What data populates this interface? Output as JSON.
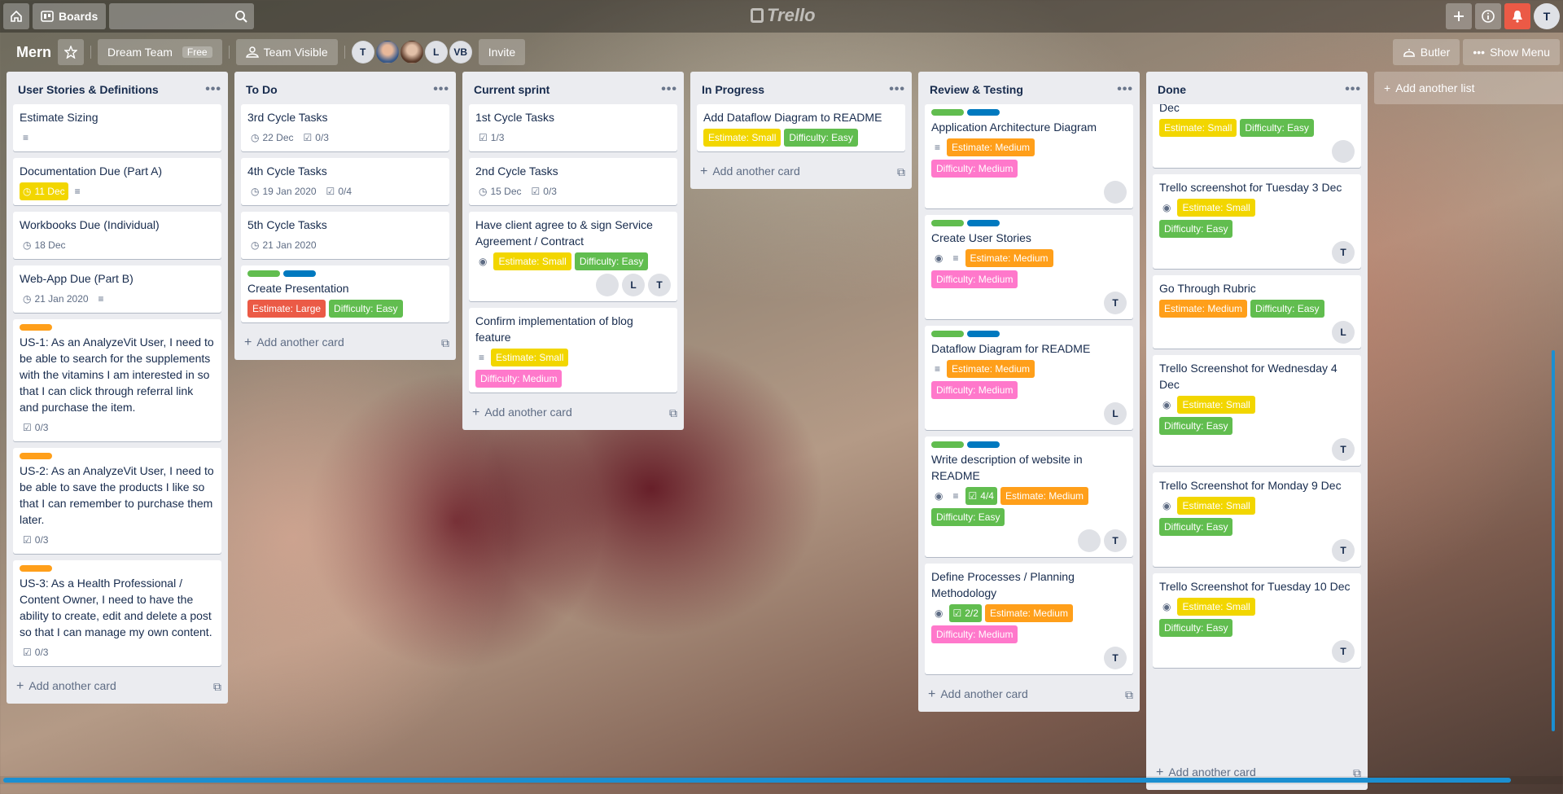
{
  "topbar": {
    "boards_label": "Boards",
    "logo": "Trello",
    "user_initial": "T"
  },
  "board": {
    "name": "Mern",
    "team": "Dream Team",
    "team_badge": "Free",
    "visibility": "Team Visible",
    "members": [
      "T",
      "L",
      "VB"
    ],
    "invite": "Invite",
    "butler": "Butler",
    "show_menu": "Show Menu"
  },
  "common": {
    "add_card": "Add another card",
    "add_list": "Add another list"
  },
  "lists": [
    {
      "title": "User Stories & Definitions",
      "cards": [
        {
          "title": "Estimate Sizing"
        },
        {
          "title": "Documentation Due (Part A)",
          "due": "11 Dec"
        },
        {
          "title": "Workbooks Due (Individual)",
          "due": "18 Dec"
        },
        {
          "title": "Web-App Due (Part B)",
          "due": "21 Jan 2020"
        },
        {
          "title": "US-1: As an AnalyzeVit User, I need to be able to search for the supplements with the vitamins I am interested in so that I can click through referral link and purchase the item.",
          "checklist": "0/3"
        },
        {
          "title": "US-2: As an AnalyzeVit User, I need to be able to save the products I like so that I can remember to purchase them later.",
          "checklist": "0/3"
        },
        {
          "title": "US-3: As a Health Professional / Content Owner, I need to have the ability to create, edit and delete a post so that I can manage my own content.",
          "checklist": "0/3"
        }
      ]
    },
    {
      "title": "To Do",
      "cards": [
        {
          "title": "3rd Cycle Tasks",
          "due": "22 Dec",
          "checklist": "0/3"
        },
        {
          "title": "4th Cycle Tasks",
          "due": "19 Jan 2020",
          "checklist": "0/4"
        },
        {
          "title": "5th Cycle Tasks",
          "due": "21 Jan 2020"
        },
        {
          "title": "Create Presentation",
          "estimate": "Estimate: Large",
          "difficulty": "Difficulty: Easy"
        }
      ]
    },
    {
      "title": "Current sprint",
      "cards": [
        {
          "title": "1st Cycle Tasks",
          "checklist": "1/3"
        },
        {
          "title": "2nd Cycle Tasks",
          "due": "15 Dec",
          "checklist": "0/3"
        },
        {
          "title": "Have client agree to & sign Service Agreement / Contract",
          "estimate": "Estimate: Small",
          "difficulty": "Difficulty: Easy",
          "members": [
            "L",
            "T"
          ]
        },
        {
          "title": "Confirm implementation of blog feature",
          "estimate": "Estimate: Small",
          "difficulty": "Difficulty: Medium"
        }
      ]
    },
    {
      "title": "In Progress",
      "cards": [
        {
          "title": "Add Dataflow Diagram to README",
          "estimate": "Estimate: Small",
          "difficulty": "Difficulty: Easy"
        }
      ]
    },
    {
      "title": "Review & Testing",
      "cards": [
        {
          "title": "Application Architecture Diagram",
          "estimate": "Estimate: Medium",
          "difficulty": "Difficulty: Medium"
        },
        {
          "title": "Create User Stories",
          "estimate": "Estimate: Medium",
          "difficulty": "Difficulty: Medium",
          "member": "T"
        },
        {
          "title": "Dataflow Diagram for README",
          "estimate": "Estimate: Medium",
          "difficulty": "Difficulty: Medium",
          "member": "L"
        },
        {
          "title": "Write description of website in README",
          "checklist": "4/4",
          "estimate": "Estimate: Medium",
          "difficulty": "Difficulty: Easy",
          "member": "T"
        },
        {
          "title": "Define Processes / Planning Methodology",
          "checklist": "2/2",
          "estimate": "Estimate: Medium",
          "difficulty": "Difficulty: Medium",
          "member": "T"
        }
      ]
    },
    {
      "title": "Done",
      "cards": [
        {
          "title": "Dec",
          "estimate": "Estimate: Small",
          "difficulty": "Difficulty: Easy"
        },
        {
          "title": "Trello screenshot for Tuesday 3 Dec",
          "estimate": "Estimate: Small",
          "difficulty": "Difficulty: Easy",
          "member": "T"
        },
        {
          "title": "Go Through Rubric",
          "estimate": "Estimate: Medium",
          "difficulty": "Difficulty: Easy",
          "member": "L"
        },
        {
          "title": "Trello Screenshot for Wednesday 4 Dec",
          "estimate": "Estimate: Small",
          "difficulty": "Difficulty: Easy",
          "member": "T"
        },
        {
          "title": "Trello Screenshot for Monday 9 Dec",
          "estimate": "Estimate: Small",
          "difficulty": "Difficulty: Easy",
          "member": "T"
        },
        {
          "title": "Trello Screenshot for Tuesday 10 Dec",
          "estimate": "Estimate: Small",
          "difficulty": "Difficulty: Easy",
          "member": "T"
        }
      ]
    }
  ]
}
